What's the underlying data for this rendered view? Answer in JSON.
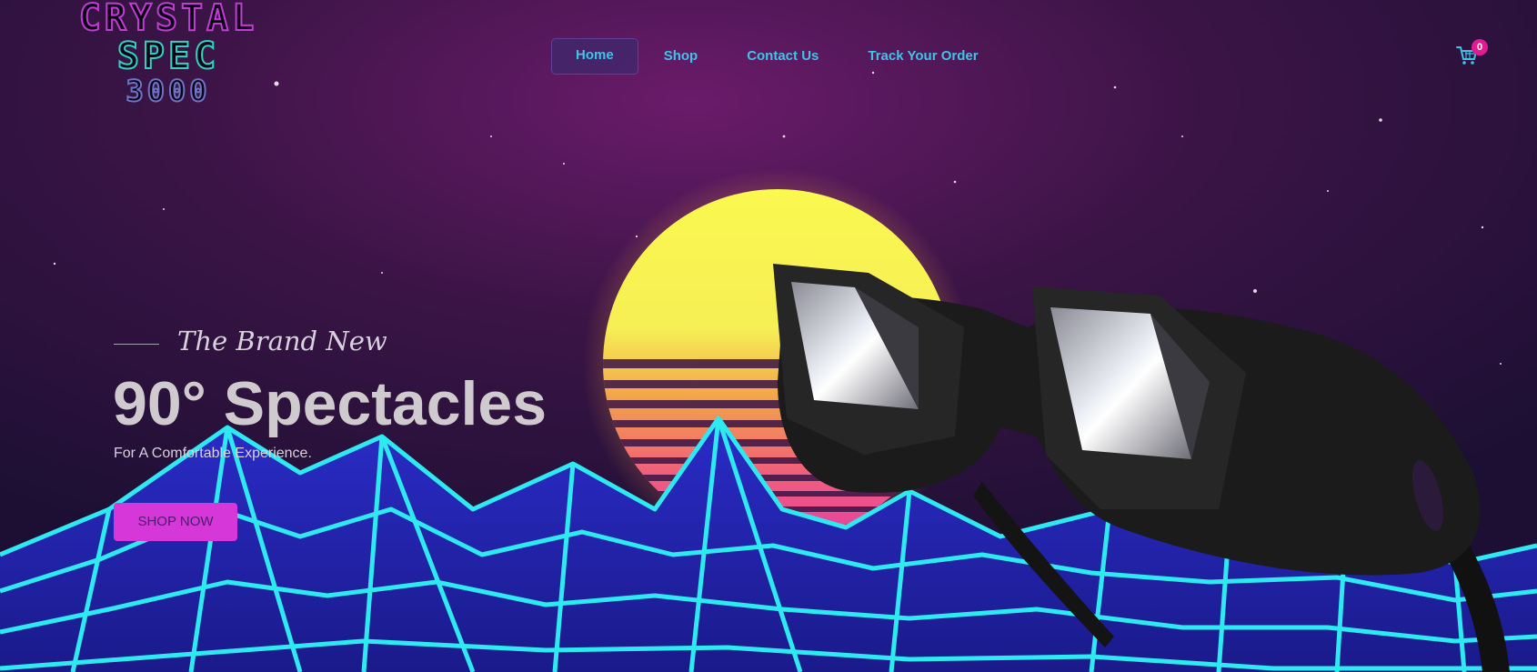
{
  "logo": {
    "line1": "CRYSTAL",
    "line2": "SPEC",
    "line3": "3000"
  },
  "nav": {
    "items": [
      {
        "label": "Home",
        "active": true
      },
      {
        "label": "Shop",
        "active": false
      },
      {
        "label": "Contact Us",
        "active": false
      },
      {
        "label": "Track Your Order",
        "active": false
      }
    ]
  },
  "cart": {
    "icon": "shopping-cart-icon",
    "count": "0"
  },
  "hero": {
    "kicker": "The Brand New",
    "headline": "90° Spectacles",
    "subline": "For A Comfortable Experience.",
    "cta_label": "SHOP NOW"
  },
  "colors": {
    "accent_pink": "#d637d8",
    "nav_text": "#3ec4e8",
    "badge": "#e11c8f",
    "sun_yellow": "#f7f052",
    "grid_cyan": "#2ee9f0"
  }
}
